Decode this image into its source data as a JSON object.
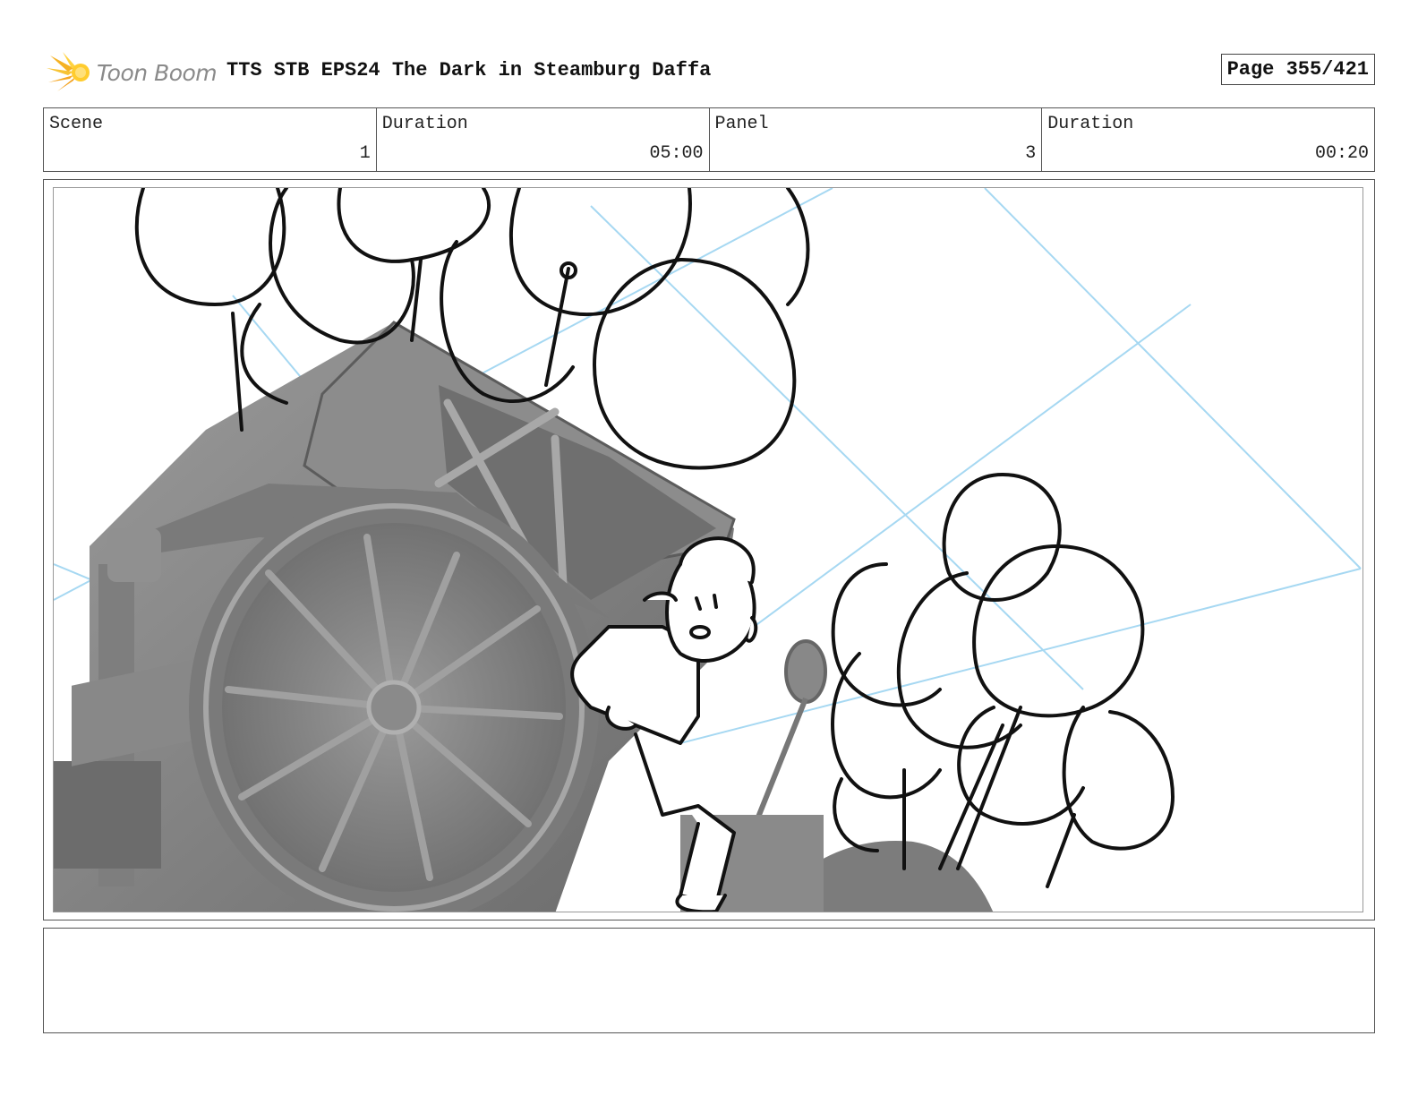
{
  "header": {
    "logo_text": "Toon Boom",
    "title": "TTS STB EPS24 The Dark in Steamburg Daffa",
    "page_label": "Page 355/421"
  },
  "info": {
    "scene_label": "Scene",
    "scene_value": "1",
    "duration_label": "Duration",
    "duration_value": "05:00",
    "panel_label": "Panel",
    "panel_value": "3",
    "panel_duration_label": "Duration",
    "panel_duration_value": "00:20"
  },
  "icons": {
    "logo": "sunburst-logo-icon"
  },
  "colors": {
    "logo_orange": "#f5a623",
    "logo_yellow": "#ffd23f",
    "guide_blue": "#8fd0ef",
    "model_gray": "#8a8a8a",
    "sketch_black": "#111111"
  },
  "notes": {
    "text": ""
  }
}
